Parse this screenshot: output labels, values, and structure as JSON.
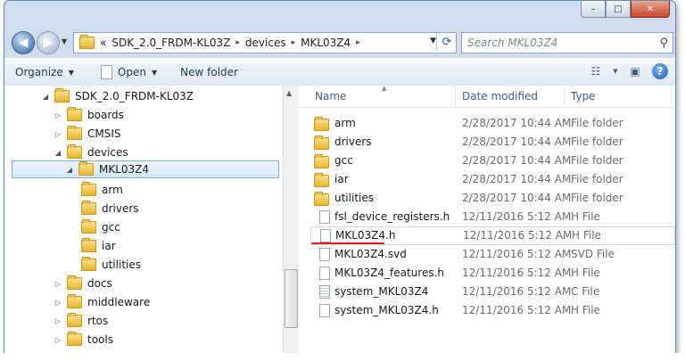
{
  "window": {
    "caption_buttons": {
      "minimize": "–",
      "maximize": "□",
      "close": "✕"
    }
  },
  "address": {
    "prefix": "«",
    "crumbs": [
      "SDK_2.0_FRDM-KL03Z",
      "devices",
      "MKL03Z4"
    ],
    "separator": "▸"
  },
  "search": {
    "placeholder": "Search MKL03Z4"
  },
  "toolbar": {
    "organize": "Organize",
    "open": "Open",
    "new_folder": "New folder",
    "help": "?"
  },
  "tree": [
    {
      "label": "SDK_2.0_FRDM-KL03Z",
      "expanded": true
    },
    {
      "label": "boards",
      "expanded": false
    },
    {
      "label": "CMSIS",
      "expanded": false
    },
    {
      "label": "devices",
      "expanded": true
    },
    {
      "label": "MKL03Z4",
      "expanded": true,
      "selected": true
    },
    {
      "label": "arm"
    },
    {
      "label": "drivers"
    },
    {
      "label": "gcc"
    },
    {
      "label": "iar"
    },
    {
      "label": "utilities"
    },
    {
      "label": "docs",
      "expanded": false
    },
    {
      "label": "middleware",
      "expanded": false
    },
    {
      "label": "rtos",
      "expanded": false
    },
    {
      "label": "tools",
      "expanded": false
    }
  ],
  "columns": {
    "name": "Name",
    "date": "Date modified",
    "type": "Type"
  },
  "files": [
    {
      "name": "arm",
      "date": "2/28/2017 10:44 AM",
      "type": "File folder",
      "icon": "folder"
    },
    {
      "name": "drivers",
      "date": "2/28/2017 10:44 AM",
      "type": "File folder",
      "icon": "folder"
    },
    {
      "name": "gcc",
      "date": "2/28/2017 10:44 AM",
      "type": "File folder",
      "icon": "folder"
    },
    {
      "name": "iar",
      "date": "2/28/2017 10:44 AM",
      "type": "File folder",
      "icon": "folder"
    },
    {
      "name": "utilities",
      "date": "2/28/2017 10:44 AM",
      "type": "File folder",
      "icon": "folder"
    },
    {
      "name": "fsl_device_registers.h",
      "date": "12/11/2016 5:12 AM",
      "type": "H File",
      "icon": "file"
    },
    {
      "name": "MKL03Z4.h",
      "date": "12/11/2016 5:12 AM",
      "type": "H File",
      "icon": "file",
      "hot": true
    },
    {
      "name": "MKL03Z4.svd",
      "date": "12/11/2016 5:12 AM",
      "type": "SVD File",
      "icon": "file"
    },
    {
      "name": "MKL03Z4_features.h",
      "date": "12/11/2016 5:12 AM",
      "type": "H File",
      "icon": "file"
    },
    {
      "name": "system_MKL03Z4",
      "date": "12/11/2016 5:12 AM",
      "type": "C File",
      "icon": "file-lines"
    },
    {
      "name": "system_MKL03Z4.h",
      "date": "12/11/2016 5:12 AM",
      "type": "H File",
      "icon": "file"
    }
  ],
  "colors": {
    "accent": "#1e395b",
    "selection": "#cce8ff",
    "annotation_underline": "#e02020"
  }
}
